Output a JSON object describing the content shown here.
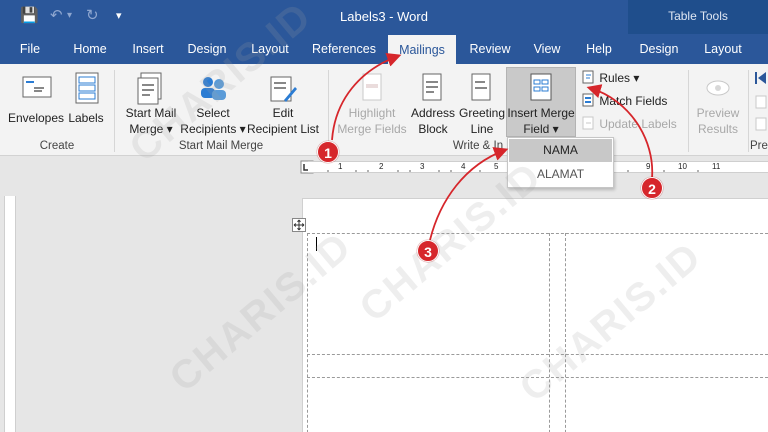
{
  "titlebar": {
    "title": "Labels3  -  Word",
    "context_tab_group": "Table Tools",
    "qa_save": "💾",
    "qa_undo": "↶",
    "qa_undo_arrow": "▾",
    "qa_redo": "↻",
    "qa_customize": "▾"
  },
  "tabs": [
    {
      "label": "File"
    },
    {
      "label": "Home"
    },
    {
      "label": "Insert"
    },
    {
      "label": "Design"
    },
    {
      "label": "Layout"
    },
    {
      "label": "References"
    },
    {
      "label": "Mailings"
    },
    {
      "label": "Review"
    },
    {
      "label": "View"
    },
    {
      "label": "Help"
    },
    {
      "label": "Design"
    },
    {
      "label": "Layout"
    }
  ],
  "ribbon": {
    "create": {
      "label": "Create",
      "envelopes": "Envelopes",
      "labels": "Labels"
    },
    "start_mail_merge": {
      "label": "Start Mail Merge",
      "start_line1": "Start Mail",
      "start_line2": "Merge ▾",
      "select_line1": "Select",
      "select_line2": "Recipients ▾",
      "edit_line1": "Edit",
      "edit_line2": "Recipient List"
    },
    "write_insert": {
      "label": "Write & In",
      "highlight_line1": "Highlight",
      "highlight_line2": "Merge Fields",
      "address_line1": "Address",
      "address_line2": "Block",
      "greeting_line1": "Greeting",
      "greeting_line2": "Line",
      "insert_line1": "Insert Merge",
      "insert_line2": "Field ▾",
      "rules": "Rules ▾",
      "match_fields": "Match Fields",
      "update_labels": "Update Labels"
    },
    "preview": {
      "label": "Prev",
      "preview_line1": "Preview",
      "preview_line2": "Results"
    }
  },
  "dropdown": {
    "items": [
      {
        "label": "NAMA"
      },
      {
        "label": "ALAMAT"
      }
    ]
  },
  "ruler": {
    "numbers": [
      "1",
      "2",
      "3",
      "4",
      "5",
      "6",
      "7",
      "8",
      "9",
      "10",
      "11"
    ]
  },
  "annotations": {
    "step1": "1",
    "step2": "2",
    "step3": "3"
  },
  "watermark": "CHARIS.ID",
  "colors": {
    "word_blue": "#2b579a",
    "context_blue": "#1f4e8c",
    "annotation_red": "#d6262b"
  }
}
